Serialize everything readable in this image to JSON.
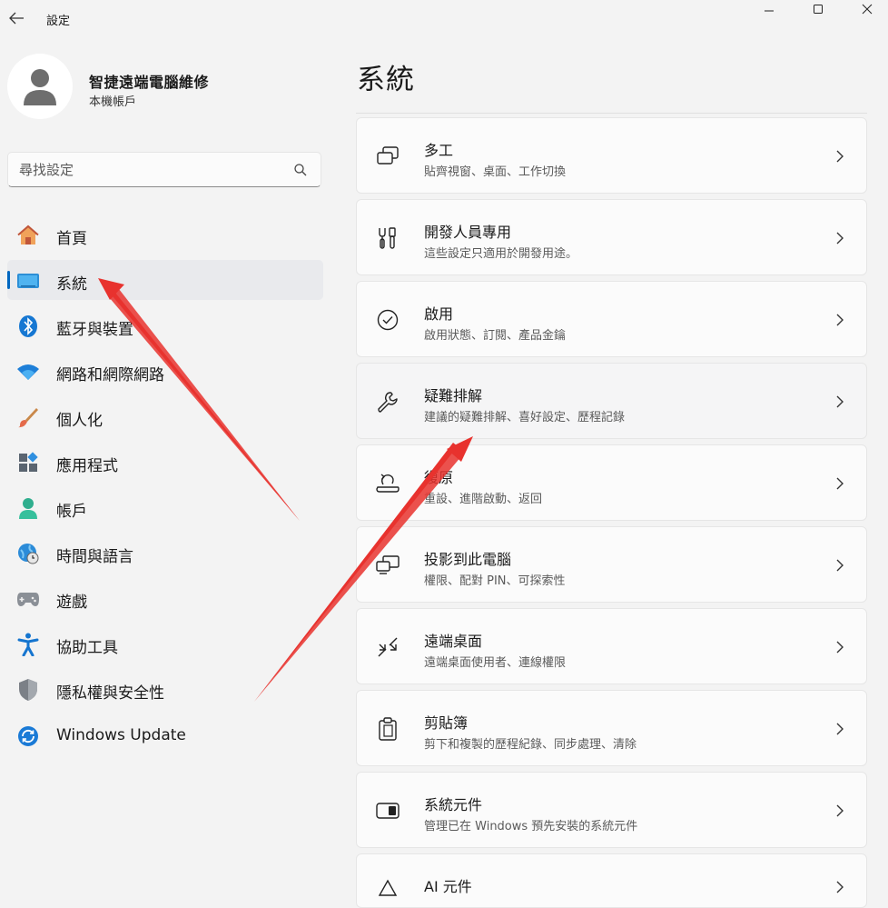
{
  "window": {
    "title": "設定",
    "back_icon": "arrow-left-icon",
    "controls": [
      "minimize-icon",
      "maximize-icon",
      "close-icon"
    ]
  },
  "account": {
    "name": "智捷遠端電腦維修",
    "type": "本機帳戶",
    "avatar_icon": "person-avatar-icon"
  },
  "search": {
    "placeholder": "尋找設定",
    "icon": "search-icon"
  },
  "sidebar": {
    "items": [
      {
        "label": "首頁",
        "icon": "home-icon"
      },
      {
        "label": "系統",
        "icon": "system-display-icon",
        "selected": true
      },
      {
        "label": "藍牙與裝置",
        "icon": "bluetooth-icon"
      },
      {
        "label": "網路和網際網路",
        "icon": "wifi-icon"
      },
      {
        "label": "個人化",
        "icon": "brush-icon"
      },
      {
        "label": "應用程式",
        "icon": "apps-icon"
      },
      {
        "label": "帳戶",
        "icon": "account-icon"
      },
      {
        "label": "時間與語言",
        "icon": "globe-clock-icon"
      },
      {
        "label": "遊戲",
        "icon": "gamepad-icon"
      },
      {
        "label": "協助工具",
        "icon": "accessibility-icon"
      },
      {
        "label": "隱私權與安全性",
        "icon": "shield-icon"
      },
      {
        "label": "Windows Update",
        "icon": "windows-update-icon"
      }
    ]
  },
  "main": {
    "title": "系統",
    "cards": [
      {
        "title": "多工",
        "desc": "貼齊視窗、桌面、工作切換",
        "icon": "multitasking-icon"
      },
      {
        "title": "開發人員專用",
        "desc": "這些設定只適用於開發用途。",
        "icon": "developer-tools-icon"
      },
      {
        "title": "啟用",
        "desc": "啟用狀態、訂閱、產品金鑰",
        "icon": "activation-check-icon"
      },
      {
        "title": "疑難排解",
        "desc": "建議的疑難排解、喜好設定、歷程記錄",
        "icon": "wrench-icon"
      },
      {
        "title": "復原",
        "desc": "重設、進階啟動、返回",
        "icon": "recovery-icon"
      },
      {
        "title": "投影到此電腦",
        "desc": "權限、配對 PIN、可探索性",
        "icon": "project-screen-icon"
      },
      {
        "title": "遠端桌面",
        "desc": "遠端桌面使用者、連線權限",
        "icon": "remote-desktop-icon"
      },
      {
        "title": "剪貼簿",
        "desc": "剪下和複製的歷程紀錄、同步處理、清除",
        "icon": "clipboard-icon"
      },
      {
        "title": "系統元件",
        "desc": "管理已在 Windows 預先安裝的系統元件",
        "icon": "system-components-icon"
      },
      {
        "title": "AI 元件",
        "desc": "",
        "icon": "ai-components-icon"
      }
    ]
  },
  "annotations": {
    "arrow_color": "#e8322e",
    "accent": "#0067c0"
  }
}
